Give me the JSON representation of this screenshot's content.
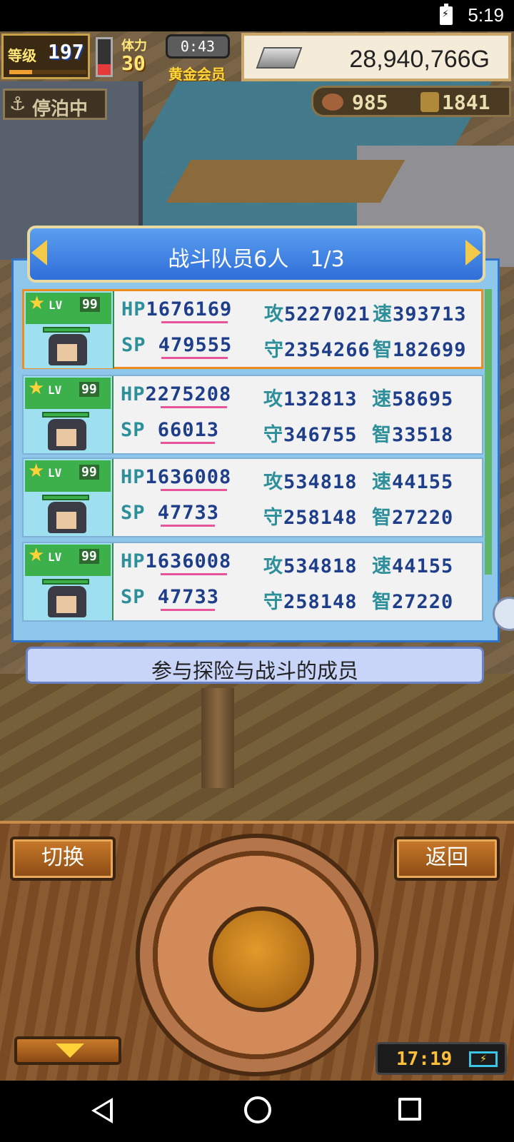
{
  "status_bar": {
    "time": "5:19"
  },
  "hud": {
    "level_label": "等级",
    "level": "197",
    "exp_fraction": 0.3,
    "hp_fraction": 0.3,
    "stamina_label": "体力",
    "stamina": "30",
    "timer": "0:43",
    "membership": "黄金会员",
    "gold": "28,940,766G",
    "dock_status": "停泊中",
    "resource_1": "985",
    "resource_2": "1841"
  },
  "panel": {
    "title": "战斗队员6人　1/3",
    "footer": "参与探险与战斗的成员"
  },
  "members": [
    {
      "level_label": "LV",
      "level": "99",
      "hp_tag": "HP",
      "hp": "1676169",
      "atk_tag": "攻",
      "atk": "5227021",
      "spd_tag": "速",
      "spd": "393713",
      "sp_tag": "SP",
      "sp": "479555",
      "def_tag": "守",
      "def": "2354266",
      "int_tag": "智",
      "int": "182699"
    },
    {
      "level_label": "LV",
      "level": "99",
      "hp_tag": "HP",
      "hp": "2275208",
      "atk_tag": "攻",
      "atk": "132813",
      "spd_tag": "速",
      "spd": "58695",
      "sp_tag": "SP",
      "sp": "66013",
      "def_tag": "守",
      "def": "346755",
      "int_tag": "智",
      "int": "33518"
    },
    {
      "level_label": "LV",
      "level": "99",
      "hp_tag": "HP",
      "hp": "1636008",
      "atk_tag": "攻",
      "atk": "534818",
      "spd_tag": "速",
      "spd": "44155",
      "sp_tag": "SP",
      "sp": "47733",
      "def_tag": "守",
      "def": "258148",
      "int_tag": "智",
      "int": "27220"
    },
    {
      "level_label": "LV",
      "level": "99",
      "hp_tag": "HP",
      "hp": "1636008",
      "atk_tag": "攻",
      "atk": "534818",
      "spd_tag": "速",
      "spd": "44155",
      "sp_tag": "SP",
      "sp": "47733",
      "def_tag": "守",
      "def": "258148",
      "int_tag": "智",
      "int": "27220"
    }
  ],
  "controls": {
    "switch_label": "切换",
    "back_label": "返回",
    "clock": "17:19"
  }
}
